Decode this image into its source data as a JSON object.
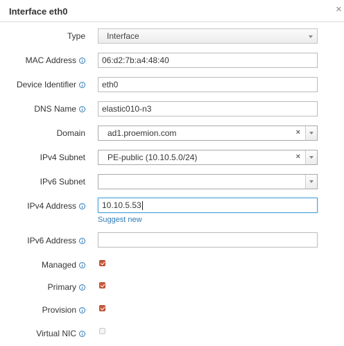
{
  "dialog": {
    "title": "Interface eth0",
    "close_glyph": "×"
  },
  "fields": {
    "type": {
      "label": "Type",
      "value": "Interface"
    },
    "mac_address": {
      "label": "MAC Address",
      "value": "06:d2:7b:a4:48:40"
    },
    "device_identifier": {
      "label": "Device Identifier",
      "value": "eth0"
    },
    "dns_name": {
      "label": "DNS Name",
      "value": "elastic010-n3"
    },
    "domain": {
      "label": "Domain",
      "value": "ad1.proemion.com"
    },
    "ipv4_subnet": {
      "label": "IPv4 Subnet",
      "value": "PE-public (10.10.5.0/24)"
    },
    "ipv6_subnet": {
      "label": "IPv6 Subnet",
      "value": ""
    },
    "ipv4_address": {
      "label": "IPv4 Address",
      "value": "10.10.5.53",
      "suggest_label": "Suggest new"
    },
    "ipv6_address": {
      "label": "IPv6 Address",
      "value": ""
    },
    "managed": {
      "label": "Managed",
      "checked": true
    },
    "primary": {
      "label": "Primary",
      "checked": true
    },
    "provision": {
      "label": "Provision",
      "checked": true
    },
    "virtual_nic": {
      "label": "Virtual NIC",
      "checked": false
    }
  },
  "icons": {
    "info": "info-icon",
    "clear": "×"
  },
  "colors": {
    "link": "#2f7ab6",
    "checkbox_checked": "#c8593b",
    "focus_border": "#4ea5da"
  }
}
